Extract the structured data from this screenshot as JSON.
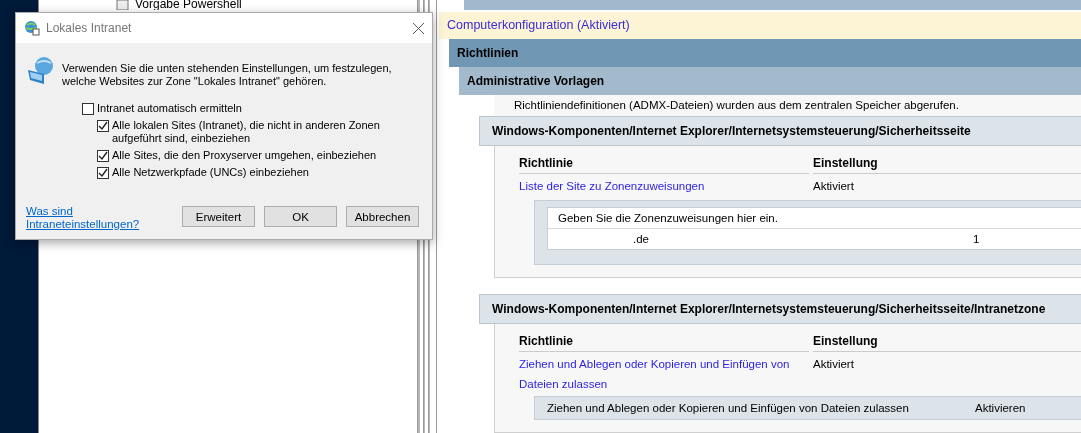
{
  "tree": {
    "item": "Vorgabe Powershell"
  },
  "report": {
    "heading": "Computerkonfiguration (Aktiviert)",
    "level1": "Richtlinien",
    "level2": "Administrative Vorlagen",
    "note": "Richtliniendefinitionen (ADMX-Dateien) wurden aus dem zentralen Speicher abgerufen.",
    "sections": [
      {
        "title": "Windows-Komponenten/Internet Explorer/Internetsystemsteuerung/Sicherheitsseite",
        "columns": [
          "Richtlinie",
          "Einstellung"
        ],
        "policies": [
          {
            "name": "Liste der Site zu Zonenzuweisungen",
            "setting": "Aktiviert",
            "details": {
              "kind": "table",
              "header": "Geben Sie die Zonenzuweisungen hier ein.",
              "rows": [
                [
                  ".de",
                  "1"
                ]
              ]
            }
          }
        ]
      },
      {
        "title": "Windows-Komponenten/Internet Explorer/Internetsystemsteuerung/Sicherheitsseite/Intranetzone",
        "columns": [
          "Richtlinie",
          "Einstellung"
        ],
        "policies": [
          {
            "name": "Ziehen und Ablegen oder Kopieren und Einfügen von Dateien zulassen",
            "setting": "Aktiviert",
            "details": {
              "kind": "value",
              "cells": [
                "Ziehen und Ablegen oder Kopieren und Einfügen von Dateien zulassen",
                "Aktivieren"
              ]
            }
          }
        ]
      }
    ]
  },
  "dialog": {
    "title": "Lokales Intranet",
    "description": "Verwenden Sie die unten stehenden Einstellungen, um festzulegen, welche Websites zur Zone \"Lokales Intranet\" gehören.",
    "options": [
      {
        "kind": "main",
        "label": "Intranet automatisch ermitteln",
        "checked": false
      },
      {
        "kind": "sub",
        "label": "Alle lokalen Sites (Intranet), die nicht in anderen Zonen aufgeführt sind, einbeziehen",
        "checked": true
      },
      {
        "kind": "sub",
        "label": "Alle Sites, die den Proxyserver umgehen, einbeziehen",
        "checked": true
      },
      {
        "kind": "sub",
        "label": "Alle Netzwerkpfade (UNCs) einbeziehen",
        "checked": true
      }
    ],
    "link": "Was sind Intraneteinstellungen?",
    "buttons": [
      {
        "label": "Erweitert",
        "selected": false
      },
      {
        "label": "OK",
        "selected": false
      },
      {
        "label": "Abbrechen",
        "selected": false
      }
    ]
  }
}
